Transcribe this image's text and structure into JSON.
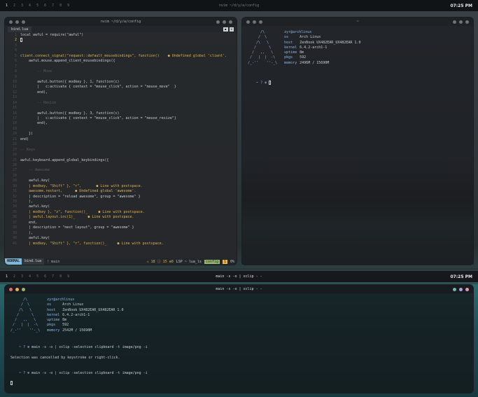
{
  "top_bar": {
    "tags": [
      "1",
      "2",
      "3",
      "4",
      "5",
      "6",
      "7",
      "8",
      "9"
    ],
    "active_tag": "1",
    "window_title": "nvim ~/d/y/a/config",
    "clock": "07:25 PM"
  },
  "bottom_bar": {
    "tags": [
      "1",
      "2",
      "3",
      "4",
      "5",
      "6",
      "7",
      "8",
      "9"
    ],
    "window_title": "main -s -o | xclip - -",
    "clock": "07:25 PM"
  },
  "nvim": {
    "title": "nvim ~/d/y/a/config",
    "tab_label": "bind.lua",
    "tab_right": [
      "◼",
      "⊗"
    ],
    "lines": [
      {
        "n": "1",
        "text": "local awful = require(\"awful\")"
      },
      {
        "n": "2",
        "text": ""
      },
      {
        "n": "3",
        "text": ""
      },
      {
        "n": "4",
        "text": ""
      },
      {
        "n": "5",
        "text": "client.connect_signal(\"request::default_mousebindings\", function()    ● Undefined global 'client'."
      },
      {
        "n": "6",
        "text": "    awful.mouse.append_client_mousebindings({"
      },
      {
        "n": "7",
        "text": ""
      },
      {
        "n": "8",
        "text": "        -- Move"
      },
      {
        "n": "9",
        "text": ""
      },
      {
        "n": "10",
        "text": "        awful.button({ modkey }, 1, function(c)"
      },
      {
        "n": "11",
        "text": "        |   c:activate { context = \"mouse_click\", action = \"mouse_move\"  }"
      },
      {
        "n": "12",
        "text": "        end),"
      },
      {
        "n": "13",
        "text": ""
      },
      {
        "n": "14",
        "text": "        -- Resize"
      },
      {
        "n": "15",
        "text": ""
      },
      {
        "n": "16",
        "text": "        awful.button({ modkey }, 3, function(c)"
      },
      {
        "n": "17",
        "text": "        |   c:activate { context = \"mouse_click\", action = \"mouse_resize\"}"
      },
      {
        "n": "18",
        "text": "        end),"
      },
      {
        "n": "19",
        "text": ""
      },
      {
        "n": "20",
        "text": "    })"
      },
      {
        "n": "21",
        "text": "end)"
      },
      {
        "n": "22",
        "text": ""
      },
      {
        "n": "23",
        "text": "-- Keys"
      },
      {
        "n": "24",
        "text": ""
      },
      {
        "n": "25",
        "text": "awful.keyboard.append_global_keybindings({"
      },
      {
        "n": "26",
        "text": ""
      },
      {
        "n": "27",
        "text": "    -- Awesome"
      },
      {
        "n": "28",
        "text": ""
      },
      {
        "n": "29",
        "text": "    awful.key("
      },
      {
        "n": "30",
        "text": "    | modkey, \"Shift\" }, \"r\",       ● Line with postspace."
      },
      {
        "n": "31",
        "text": "    awesome.restart,      ● Undefined global 'awesome'."
      },
      {
        "n": "32",
        "text": "    | description = \"reload awesome\", group = \"awesome\" }"
      },
      {
        "n": "33",
        "text": "    ),"
      },
      {
        "n": "34",
        "text": "    awful.key("
      },
      {
        "n": "35",
        "text": "    | modkey }, \"z\", function()_     ● Line with postspace."
      },
      {
        "n": "36",
        "text": "    | awful.layout.inc(1)_      ● Line with postspace."
      },
      {
        "n": "37",
        "text": "    end,"
      },
      {
        "n": "38",
        "text": "    | description = \"next layout\", group = \"awesome\" }"
      },
      {
        "n": "39",
        "text": "    ),"
      },
      {
        "n": "40",
        "text": "    awful.key("
      },
      {
        "n": "41",
        "text": "    | modkey, \"Shift\" }, \"r\", function()_     ● Line with postspace."
      }
    ],
    "status": {
      "mode": "NORMAL",
      "file": "bind.lua",
      "branch": "main",
      "diagnostics": "⚠ 18  ⓘ 15  ⊗0",
      "lsp": "LSP ~ lua_ls",
      "filetype": "config",
      "pos": "1",
      "pct": "0%"
    }
  },
  "term_right": {
    "title": "~",
    "art": [
      "      /\\",
      "     /  \\",
      "    /\\   \\",
      "   /      \\",
      "  /   ,,   \\",
      " /   |  |  -\\",
      "/_-''    ''-_\\"
    ],
    "user": "zyr@archlinux",
    "info": [
      {
        "k": "os",
        "v": "Arch Linux"
      },
      {
        "k": "host",
        "v": "ZenBook UX482EAR_UX482EAR 1.0"
      },
      {
        "k": "kernel",
        "v": "6.4.2-arch1-1"
      },
      {
        "k": "uptime",
        "v": "8m"
      },
      {
        "k": "pkgs",
        "v": "592"
      },
      {
        "k": "memory",
        "v": "2496M / 15690M"
      }
    ],
    "prompt": "~ ? ⊛"
  },
  "term_bottom": {
    "title": "main -s -o | xclip - -",
    "art": [
      "      /\\",
      "     /  \\",
      "    /\\   \\",
      "   /      \\",
      "  /   ,,   \\",
      " /   |  |  -\\",
      "/_-''    ''-_\\"
    ],
    "user": "zyr@archlinux",
    "info": [
      {
        "k": "os",
        "v": "Arch Linux"
      },
      {
        "k": "host",
        "v": "ZenBook UX482EAR_UX482EAR 1.0"
      },
      {
        "k": "kernel",
        "v": "6.4.2-arch1-1"
      },
      {
        "k": "uptime",
        "v": "8m"
      },
      {
        "k": "pkgs",
        "v": "592"
      },
      {
        "k": "memory",
        "v": "2542M / 15690M"
      }
    ],
    "cmd1_prompt": "~ ? ⊛",
    "cmd1": "main -s -o | xclip -selection clipboard -t image/png -i",
    "cmd1_out": "Selection was cancelled by keystroke or right-click.",
    "cmd2_prompt": "~ ? ⊛",
    "cmd2": "main -s -o | xclip -selection clipboard -t image/png -i"
  }
}
